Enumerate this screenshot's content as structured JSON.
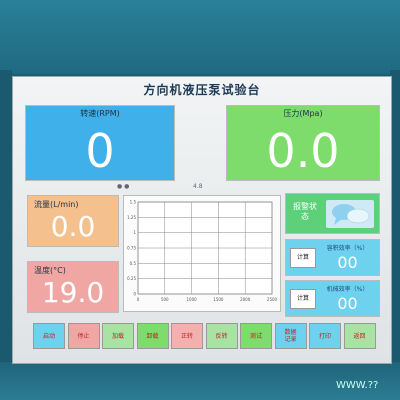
{
  "title": "方向机液压泵试验台",
  "speed": {
    "label": "转速(RPM)",
    "value": "0"
  },
  "pressure": {
    "label": "压力(Mpa)",
    "value": "0.0"
  },
  "flow": {
    "label": "流量(L/min)",
    "value": "0.0"
  },
  "temperature": {
    "label": "温度(°C)",
    "value": "19.0"
  },
  "alarm": {
    "label": "报警状态"
  },
  "efficiency_vol": {
    "label": "容积效率（%）",
    "value": "00",
    "calc": "计算"
  },
  "efficiency_mech": {
    "label": "机械效率（%）",
    "value": "00",
    "calc": "计算"
  },
  "chart_tabs": {
    "left": "● ●",
    "right": "4.8"
  },
  "chart_data": {
    "type": "line",
    "x_ticks": [
      "0",
      "500",
      "1000",
      "1500",
      "2000",
      "2500"
    ],
    "y_ticks": [
      "1.5",
      "1.25",
      "1",
      "0.75",
      "0.5",
      "0.25",
      "0"
    ],
    "series": []
  },
  "buttons": [
    {
      "label": "启动",
      "bg": "#6ed2ef"
    },
    {
      "label": "停止",
      "bg": "#f0a7a4"
    },
    {
      "label": "加载",
      "bg": "#a8e3a4"
    },
    {
      "label": "卸载",
      "bg": "#7ddc6b"
    },
    {
      "label": "正转",
      "bg": "#f4b0ae"
    },
    {
      "label": "反转",
      "bg": "#a8e3a4"
    },
    {
      "label": "测试",
      "bg": "#7ddc6b"
    },
    {
      "label": "数据\n记录",
      "bg": "#6ed2ef"
    },
    {
      "label": "打印",
      "bg": "#6ed2ef"
    },
    {
      "label": "返回",
      "bg": "#a8e3a4"
    }
  ],
  "watermark": "WWW.??"
}
